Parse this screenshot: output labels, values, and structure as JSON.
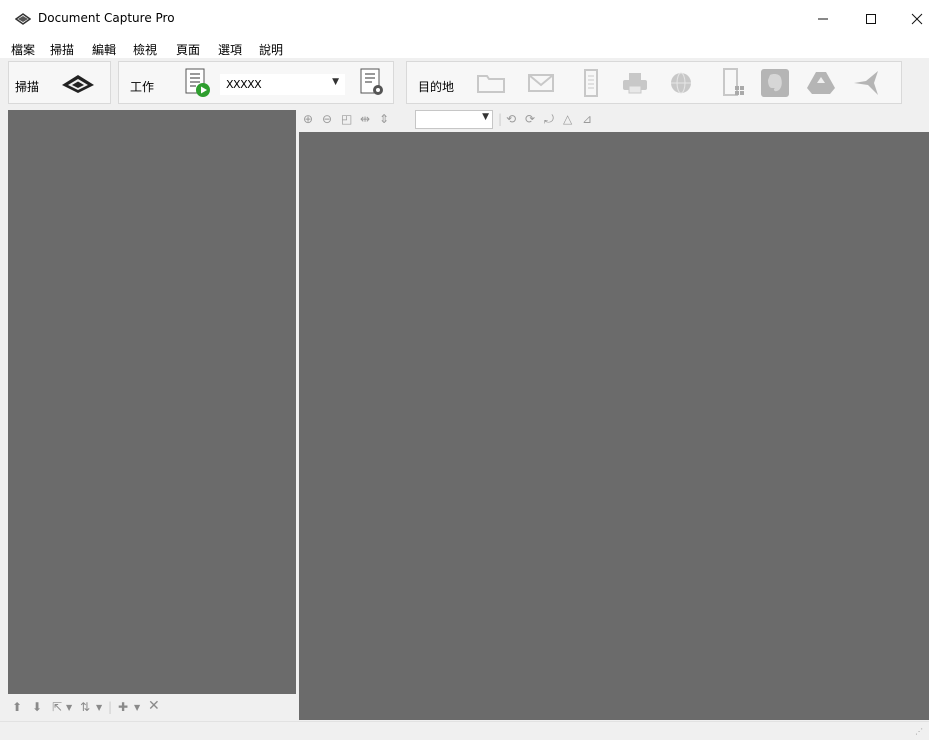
{
  "window": {
    "title": "Document Capture Pro",
    "minimize_icon": "minimize-icon",
    "maximize_icon": "maximize-icon",
    "close_icon": "close-icon"
  },
  "menu": {
    "items": [
      "檔案",
      "掃描",
      "編輯",
      "檢視",
      "頁面",
      "選項",
      "說明"
    ]
  },
  "toolbar": {
    "scan_label": "掃描",
    "job_label": "工作",
    "job_selected": "XXXXX",
    "destination_label": "目的地",
    "icons": {
      "scan": "scanner-icon",
      "run_job": "run-job-icon",
      "job_settings": "job-settings-icon",
      "folder": "folder-icon",
      "email": "email-icon",
      "document": "document-icon",
      "print": "printer-icon",
      "web": "globe-icon",
      "sharepoint": "server-icon",
      "evernote": "evernote-icon",
      "drive": "google-drive-icon",
      "bird": "bird-icon"
    }
  },
  "viewer_toolbar": {
    "zoom_value": "",
    "icons": [
      "zoom-in-icon",
      "zoom-out-icon",
      "fit-page-icon",
      "fit-width-icon",
      "fit-height-icon",
      "rotate-left-icon",
      "rotate-right-icon",
      "rotate-180-icon",
      "skew-icon",
      "skew-2-icon"
    ]
  },
  "left_toolbar": {
    "icons": [
      "move-up-icon",
      "move-down-icon",
      "select-icon",
      "sort-icon",
      "add-icon",
      "delete-icon"
    ]
  },
  "colors": {
    "panel_bg": "#6b6b6b",
    "chrome_bg": "#f0f0f0",
    "disabled_icon": "#c8c8c8"
  }
}
